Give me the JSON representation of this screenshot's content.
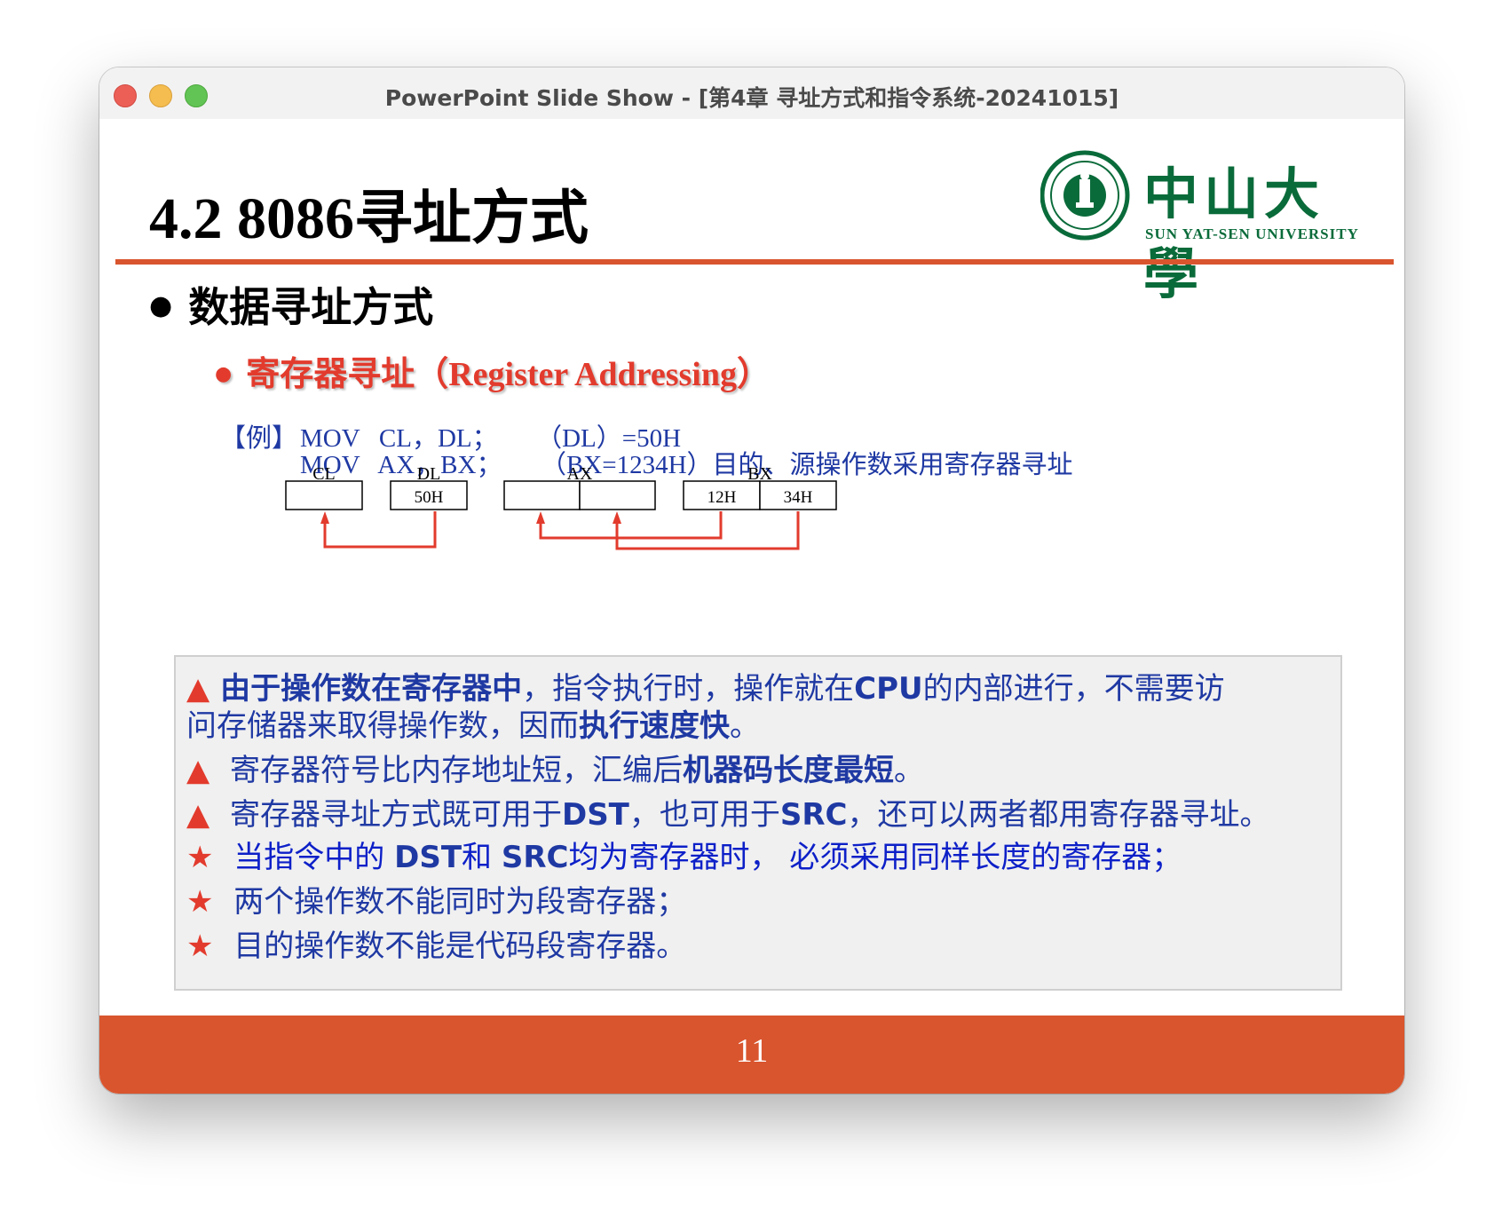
{
  "window": {
    "title": "PowerPoint Slide Show - [第4章 寻址方式和指令系统-20241015]"
  },
  "slide": {
    "title": "4.2 8086寻址方式",
    "logo": {
      "cn": "中山大學",
      "en": "SUN  YAT-SEN UNIVERSITY"
    },
    "bullet_level1": "数据寻址方式",
    "bullet_level2": {
      "cn": "寄存器寻址",
      "en": "（Register Addressing）"
    },
    "example": {
      "label": "【例】",
      "line1": "MOV   CL，DL；      （DL）=50H",
      "line2": "MOV   AX，BX；      （BX=1234H）目的、源操作数采用寄存器寻址"
    },
    "diagram": {
      "registers": [
        {
          "name": "CL",
          "cells": [
            ""
          ]
        },
        {
          "name": "DL",
          "cells": [
            "50H"
          ]
        },
        {
          "name": "AX",
          "cells": [
            "",
            ""
          ]
        },
        {
          "name": "BX",
          "cells": [
            "12H",
            "34H"
          ]
        }
      ],
      "arrow_color": "#e23b2d"
    },
    "points": [
      {
        "marker": "▲",
        "segments": [
          {
            "b": "由于操作数在寄存器中"
          },
          {
            "t": "，指令执行时，操作就在"
          },
          {
            "b": "CPU"
          },
          {
            "t": "的内部进行，不需要访"
          }
        ]
      },
      {
        "marker": "",
        "segments": [
          {
            "t": "问存储器来取得操作数，因而"
          },
          {
            "b": "执行速度快"
          },
          {
            "t": "。"
          }
        ]
      },
      {
        "marker": "▲",
        "segments": [
          {
            "t": " 寄存器符号比内存地址短，汇编后"
          },
          {
            "b": "机器码长度最短"
          },
          {
            "t": "。"
          }
        ]
      },
      {
        "marker": "▲",
        "segments": [
          {
            "t": "  寄存器寻址方式既可用于"
          },
          {
            "b": "DST"
          },
          {
            "t": "，也可用于"
          },
          {
            "b": "SRC"
          },
          {
            "t": "，还可以两者都用寄存器寻址。"
          }
        ]
      },
      {
        "marker": "★",
        "segments": [
          {
            "t": " 当指令中的 "
          },
          {
            "b": "DST"
          },
          {
            "t": "和 "
          },
          {
            "b": "SRC"
          },
          {
            "t": "均为寄存器时， 必须采用同样长度的寄存器；"
          }
        ]
      },
      {
        "marker": "★",
        "segments": [
          {
            "t": " 两个操作数不能同时为段寄存器；"
          }
        ]
      },
      {
        "marker": "★",
        "segments": [
          {
            "t": " 目的操作数不能是代码段寄存器。"
          }
        ]
      }
    ],
    "page_number": "11"
  },
  "colors": {
    "accent": "#d9552e",
    "text_blue": "#1f39a3",
    "marker_red": "#e23b2d",
    "logo_green": "#0a6b3a"
  }
}
